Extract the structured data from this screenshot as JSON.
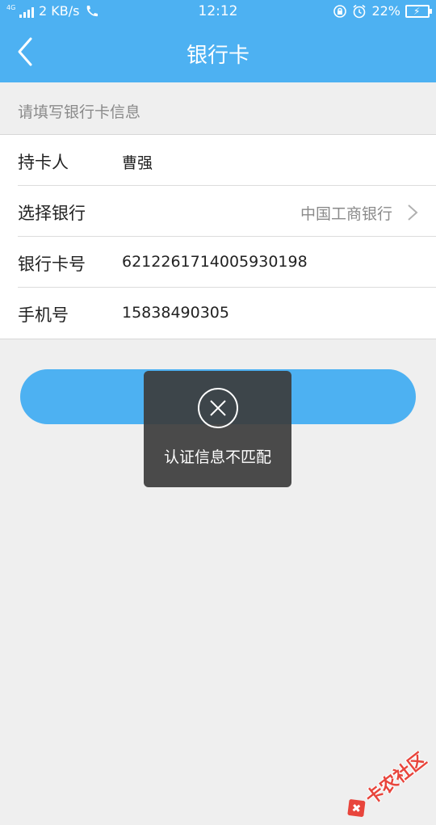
{
  "status_bar": {
    "network": "4G",
    "speed": "2 KB/s",
    "time": "12:12",
    "battery": "22%"
  },
  "header": {
    "title": "银行卡",
    "back_icon": "chevron-left-icon",
    "background": "#4db1f2"
  },
  "form": {
    "hint": "请填写银行卡信息",
    "rows": [
      {
        "label": "持卡人",
        "value": "曹强"
      },
      {
        "label": "选择银行",
        "value": "中国工商银行"
      },
      {
        "label": "银行卡号",
        "value": "6212261714005930198"
      },
      {
        "label": "手机号",
        "value": "15838490305"
      }
    ]
  },
  "submit": {
    "label": ""
  },
  "toast": {
    "icon": "close-circle-icon",
    "message": "认证信息不匹配"
  },
  "watermark": {
    "text": "卡农社区",
    "color": "#e8453c"
  }
}
